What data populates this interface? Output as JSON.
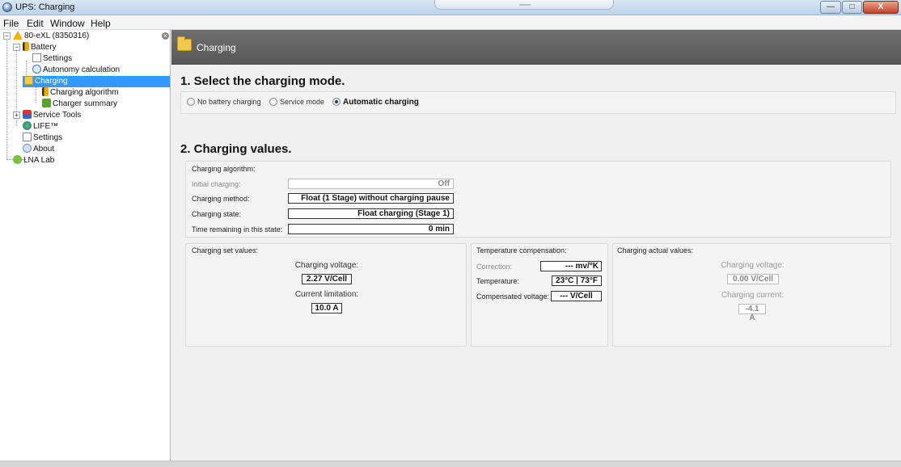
{
  "window": {
    "title": "UPS: Charging"
  },
  "menu": [
    "File",
    "Edit",
    "Window",
    "Help"
  ],
  "tree": {
    "root": "80-eXL (8350316)",
    "battery": "Battery",
    "settings": "Settings",
    "autonomy": "Autonomy calculation",
    "charging": "Charging",
    "charging_algorithm": "Charging algorithm",
    "charger_summary": "Charger summary",
    "service_tools": "Service Tools",
    "life": "LIFE™",
    "settings2": "Settings",
    "about": "About",
    "lna_lab": "LNA Lab"
  },
  "header": {
    "title": "Charging"
  },
  "section1": {
    "title": "1. Select the charging mode.",
    "modes": [
      {
        "label": "No battery charging",
        "selected": false
      },
      {
        "label": "Service mode",
        "selected": false
      },
      {
        "label": "Automatic charging",
        "selected": true
      }
    ]
  },
  "section2": {
    "title": "2. Charging values.",
    "algorithm": {
      "label": "Charging algorithm:",
      "rows": [
        {
          "label": "Initial charging:",
          "value": "Off"
        },
        {
          "label": "Charging method:",
          "value": "Float (1 Stage) without charging pause"
        },
        {
          "label": "Charging state:",
          "value": "Float charging (Stage 1)"
        },
        {
          "label": "Time remaining in this state:",
          "value": "0 min"
        }
      ]
    },
    "set_values": {
      "label": "Charging set values:",
      "voltage_label": "Charging voltage:",
      "voltage": "2.27 V/Cell",
      "current_label": "Current limitation:",
      "current": "10.0 A"
    },
    "temp_comp": {
      "label": "Temperature compensation:",
      "correction_label": "Correction:",
      "correction": "--- mv/°K",
      "temperature_label": "Temperature:",
      "temperature": "23°C | 73°F",
      "compensated_label": "Compensated voltage:",
      "compensated": "--- V/Cell"
    },
    "actual_values": {
      "label": "Charging actual values:",
      "voltage_label": "Charging voltage:",
      "voltage": "0.00 V/Cell",
      "current_label": "Charging current:",
      "current": "-4.1 A"
    }
  }
}
